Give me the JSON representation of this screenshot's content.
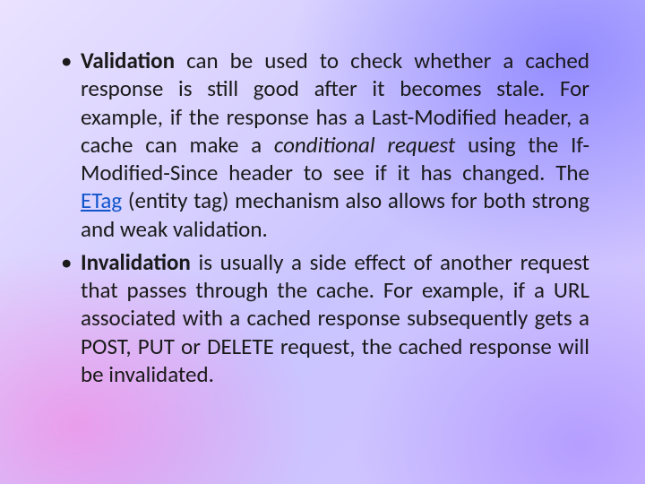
{
  "bullets": [
    {
      "lead": "Validation",
      "t1": " can be used to check whether a cached response is still good after it becomes stale. For example, if the response has a Last-Modified header, a cache can make a ",
      "em": "conditional request",
      "t2": " using the If-Modified-Since header to see if it has changed. The ",
      "link": "ETag",
      "t3": " (entity tag) mechanism also allows for both strong and weak validation."
    },
    {
      "lead": "Invalidation",
      "t1": " is usually a side effect of another request that passes through the cache. For example, if a URL associated with a cached response subsequently gets a POST, PUT or DELETE request, the cached response will be invalidated.",
      "em": "",
      "t2": "",
      "link": "",
      "t3": ""
    }
  ]
}
